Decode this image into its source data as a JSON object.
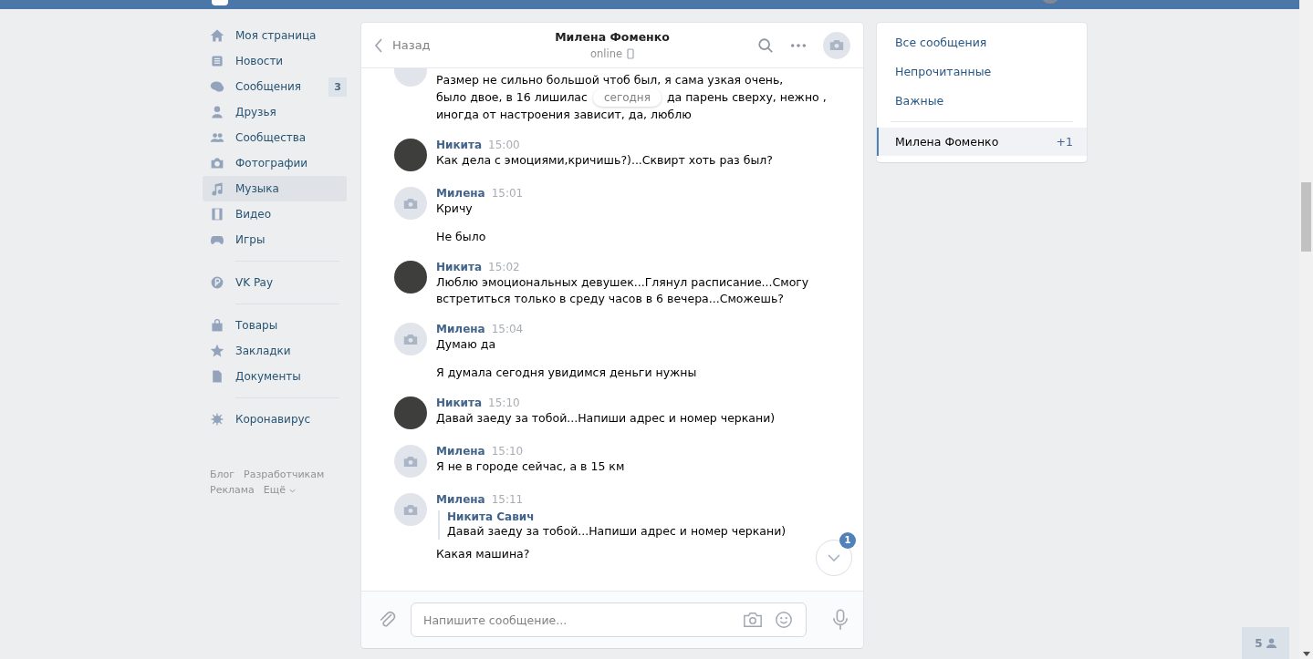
{
  "nav": {
    "groups": [
      [
        {
          "label": "Моя страница",
          "selected": false
        },
        {
          "label": "Новости",
          "selected": false
        },
        {
          "label": "Сообщения",
          "selected": false,
          "badge": "3"
        },
        {
          "label": "Друзья",
          "selected": false
        },
        {
          "label": "Сообщества",
          "selected": false
        },
        {
          "label": "Фотографии",
          "selected": false
        },
        {
          "label": "Музыка",
          "selected": true
        },
        {
          "label": "Видео",
          "selected": false
        },
        {
          "label": "Игры",
          "selected": false
        }
      ],
      [
        {
          "label": "VK Pay",
          "selected": false
        }
      ],
      [
        {
          "label": "Товары",
          "selected": false
        },
        {
          "label": "Закладки",
          "selected": false
        },
        {
          "label": "Документы",
          "selected": false
        }
      ],
      [
        {
          "label": "Коронавирус",
          "selected": false
        }
      ]
    ],
    "footer": [
      "Блог",
      "Разработчикам",
      "Реклама",
      "Ещё"
    ]
  },
  "chat": {
    "back": "Назад",
    "title": "Милена Фоменко",
    "status": "online",
    "date_divider": "сегодня",
    "partial": {
      "line_1": "Размер не сильно большой чтоб был, я сама узкая очень,",
      "line_2_start": "было двое, в 16 лишилас",
      "line_2_end": "да парень сверху, нежно ,",
      "line_3": "иногда от настроения зависит, да, люблю"
    },
    "messages": [
      {
        "kind": "photo",
        "author": "Никита",
        "time": "15:00",
        "texts": [
          "Как дела с эмоциями,кричишь?)...Сквирт хоть раз был?"
        ]
      },
      {
        "kind": "camera",
        "author": "Милена",
        "time": "15:01",
        "texts": [
          "Кричу",
          "Не было"
        ]
      },
      {
        "kind": "photo",
        "author": "Никита",
        "time": "15:02",
        "texts": [
          "Люблю эмоциональных девушек...Глянул расписание...Смогу встретиться только в среду часов в 6 вечера...Сможешь?"
        ]
      },
      {
        "kind": "camera",
        "author": "Милена",
        "time": "15:04",
        "texts": [
          "Думаю да",
          "Я думала сегодня увидимся деньги нужны"
        ]
      },
      {
        "kind": "photo",
        "author": "Никита",
        "time": "15:10",
        "texts": [
          "Давай заеду за тобой...Напиши адрес и номер черкани)"
        ]
      },
      {
        "kind": "camera",
        "author": "Милена",
        "time": "15:10",
        "texts": [
          "Я не в городе сейчас, а в 15 км"
        ]
      },
      {
        "kind": "camera",
        "author": "Милена",
        "time": "15:11",
        "quote": {
          "author": "Никита Савич",
          "text": "Давай заеду за тобой...Напиши адрес и номер черкани)"
        },
        "texts": [
          "Какая машина?"
        ]
      }
    ],
    "unread_badge": "1",
    "placeholder": "Напишите сообщение..."
  },
  "filters": [
    {
      "label": "Все сообщения",
      "selected": false
    },
    {
      "label": "Непрочитанные",
      "selected": false
    },
    {
      "label": "Важные",
      "selected": false
    }
  ],
  "conversations": [
    {
      "name": "Милена Фоменко",
      "count": "+1",
      "selected": true
    }
  ],
  "online_friends": "5"
}
